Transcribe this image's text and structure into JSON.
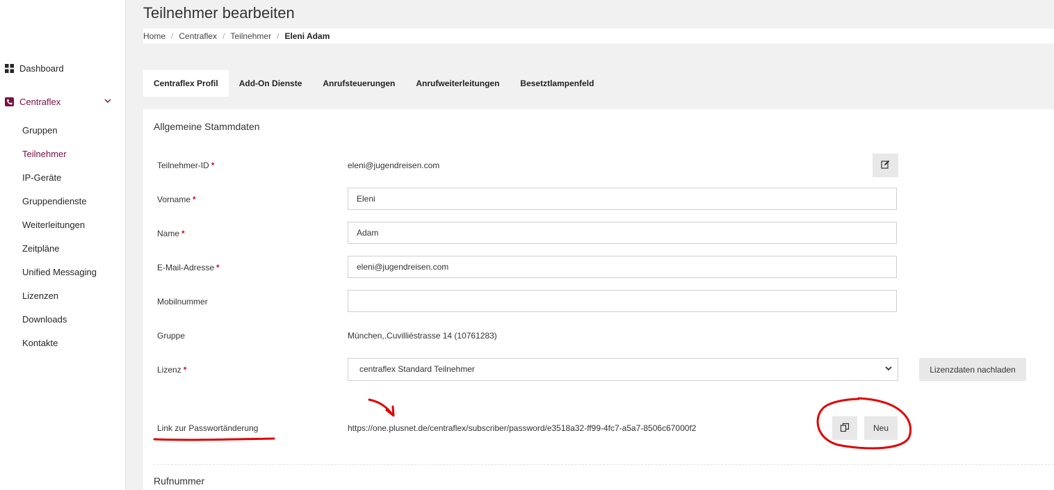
{
  "colors": {
    "accent": "#7a0f45",
    "required": "#c8102e",
    "annotation": "#e10000"
  },
  "sidebar": {
    "dashboard": {
      "label": "Dashboard",
      "icon": "grid-icon"
    },
    "centraflex": {
      "label": "Centraflex",
      "icon": "phone-icon"
    },
    "items": [
      {
        "label": "Gruppen",
        "active": false
      },
      {
        "label": "Teilnehmer",
        "active": true
      },
      {
        "label": "IP-Geräte",
        "active": false
      },
      {
        "label": "Gruppendienste",
        "active": false
      },
      {
        "label": "Weiterleitungen",
        "active": false
      },
      {
        "label": "Zeitpläne",
        "active": false
      },
      {
        "label": "Unified Messaging",
        "active": false
      },
      {
        "label": "Lizenzen",
        "active": false
      },
      {
        "label": "Downloads",
        "active": false
      },
      {
        "label": "Kontakte",
        "active": false
      }
    ]
  },
  "header": {
    "title": "Teilnehmer bearbeiten",
    "breadcrumb": [
      "Home",
      "Centraflex",
      "Teilnehmer",
      "Eleni Adam"
    ]
  },
  "tabs": [
    {
      "label": "Centraflex Profil",
      "active": true
    },
    {
      "label": "Add-On Dienste",
      "active": false
    },
    {
      "label": "Anrufsteuerungen",
      "active": false
    },
    {
      "label": "Anrufweiterleitungen",
      "active": false
    },
    {
      "label": "Besetztlampenfeld",
      "active": false
    }
  ],
  "form": {
    "section_title": "Allgemeine Stammdaten",
    "teilnehmer_id": {
      "label": "Teilnehmer-ID",
      "value": "eleni@jugendreisen.com"
    },
    "vorname": {
      "label": "Vorname",
      "value": "Eleni"
    },
    "name": {
      "label": "Name",
      "value": "Adam"
    },
    "email": {
      "label": "E-Mail-Adresse",
      "value": "eleni@jugendreisen.com"
    },
    "mobil": {
      "label": "Mobilnummer",
      "value": ""
    },
    "gruppe": {
      "label": "Gruppe",
      "value": "München,.Cuvilliéstrasse 14 (10761283)"
    },
    "lizenz": {
      "label": "Lizenz",
      "value": "centraflex Standard Teilnehmer",
      "reload_label": "Lizenzdaten nachladen"
    },
    "password_link": {
      "label": "Link zur Passwortänderung",
      "value": "https://one.plusnet.de/centraflex/subscriber/password/e3518a32-ff99-4fc7-a5a7-8506c67000f2",
      "new_label": "Neu"
    },
    "next_section_title": "Rufnummer",
    "required_mark": "*"
  }
}
